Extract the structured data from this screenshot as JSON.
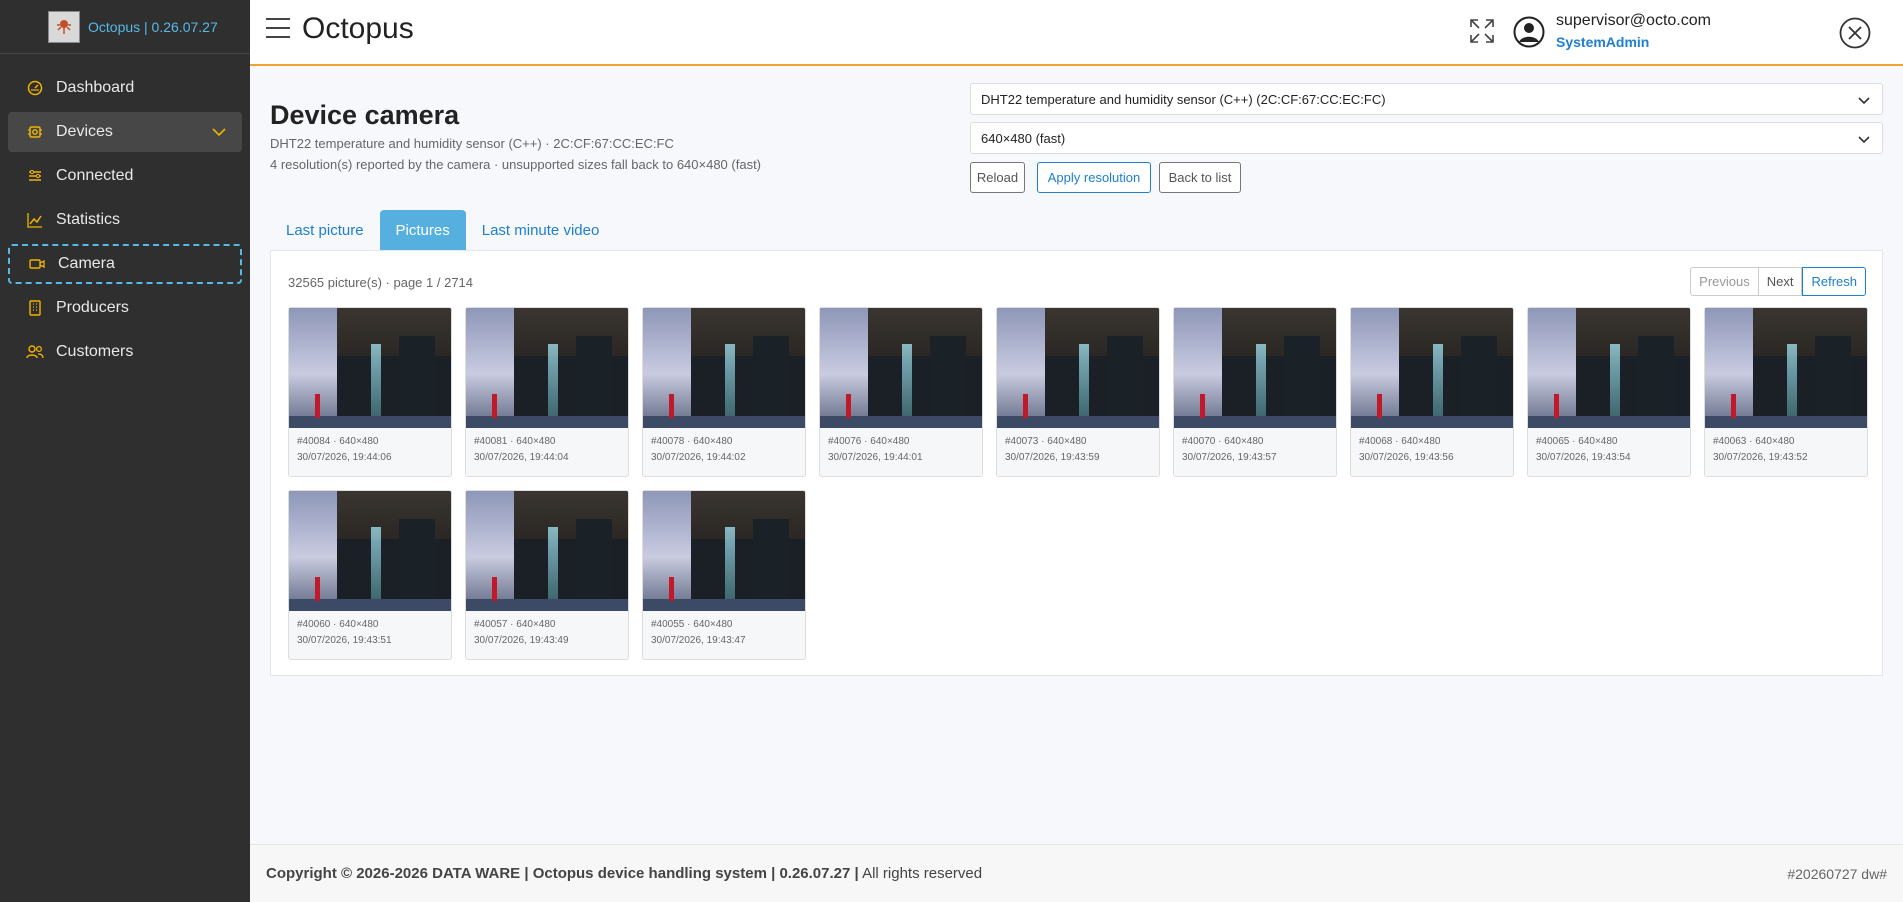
{
  "app": {
    "version_label": "Octopus | 0.26.07.27",
    "title": "Octopus"
  },
  "sidebar": {
    "items": [
      {
        "label": "Dashboard",
        "icon": "dashboard-icon"
      },
      {
        "label": "Devices",
        "icon": "devices-icon"
      },
      {
        "label": "Connected",
        "icon": "connected-icon"
      },
      {
        "label": "Statistics",
        "icon": "statistics-icon"
      },
      {
        "label": "Camera",
        "icon": "camera-icon"
      },
      {
        "label": "Producers",
        "icon": "producers-icon"
      },
      {
        "label": "Customers",
        "icon": "customers-icon"
      }
    ]
  },
  "header": {
    "user_email": "supervisor@octo.com",
    "user_role": "SystemAdmin"
  },
  "page": {
    "title": "Device camera",
    "device_line": "DHT22 temperature and humidity sensor (C++) · 2C:CF:67:CC:EC:FC",
    "resolution_note": "4 resolution(s) reported by the camera · unsupported sizes fall back to 640×480 (fast)",
    "device_select_value": "DHT22 temperature and humidity sensor (C++) (2C:CF:67:CC:EC:FC)",
    "resolution_select_value": "640×480 (fast)",
    "buttons": {
      "reload": "Reload",
      "apply": "Apply resolution",
      "back": "Back to list"
    },
    "tabs": [
      "Last picture",
      "Pictures",
      "Last minute video"
    ],
    "active_tab": "Pictures"
  },
  "pictures": {
    "count_text": "32565 picture(s) · page 1 / 2714",
    "pager": {
      "previous": "Previous",
      "next": "Next",
      "refresh": "Refresh"
    },
    "items": [
      {
        "caption": "#40084 · 640×480",
        "timestamp": "30/07/2026, 19:44:06"
      },
      {
        "caption": "#40081 · 640×480",
        "timestamp": "30/07/2026, 19:44:04"
      },
      {
        "caption": "#40078 · 640×480",
        "timestamp": "30/07/2026, 19:44:02"
      },
      {
        "caption": "#40076 · 640×480",
        "timestamp": "30/07/2026, 19:44:01"
      },
      {
        "caption": "#40073 · 640×480",
        "timestamp": "30/07/2026, 19:43:59"
      },
      {
        "caption": "#40070 · 640×480",
        "timestamp": "30/07/2026, 19:43:57"
      },
      {
        "caption": "#40068 · 640×480",
        "timestamp": "30/07/2026, 19:43:56"
      },
      {
        "caption": "#40065 · 640×480",
        "timestamp": "30/07/2026, 19:43:54"
      },
      {
        "caption": "#40063 · 640×480",
        "timestamp": "30/07/2026, 19:43:52"
      },
      {
        "caption": "#40060 · 640×480",
        "timestamp": "30/07/2026, 19:43:51"
      },
      {
        "caption": "#40057 · 640×480",
        "timestamp": "30/07/2026, 19:43:49"
      },
      {
        "caption": "#40055 · 640×480",
        "timestamp": "30/07/2026, 19:43:47"
      }
    ]
  },
  "footer": {
    "copyright": "Copyright © 2026-2026 DATA WARE | Octopus device handling system | 0.26.07.27 |",
    "rights": "All rights reserved",
    "build": "#20260727 dw#"
  },
  "colors": {
    "sidebar_bg": "#2f2f2f",
    "accent_blue": "#1e7fd0",
    "brand_cyan": "#56b9e6",
    "header_underline": "#f0a530",
    "nav_icon": "#f0b400"
  }
}
